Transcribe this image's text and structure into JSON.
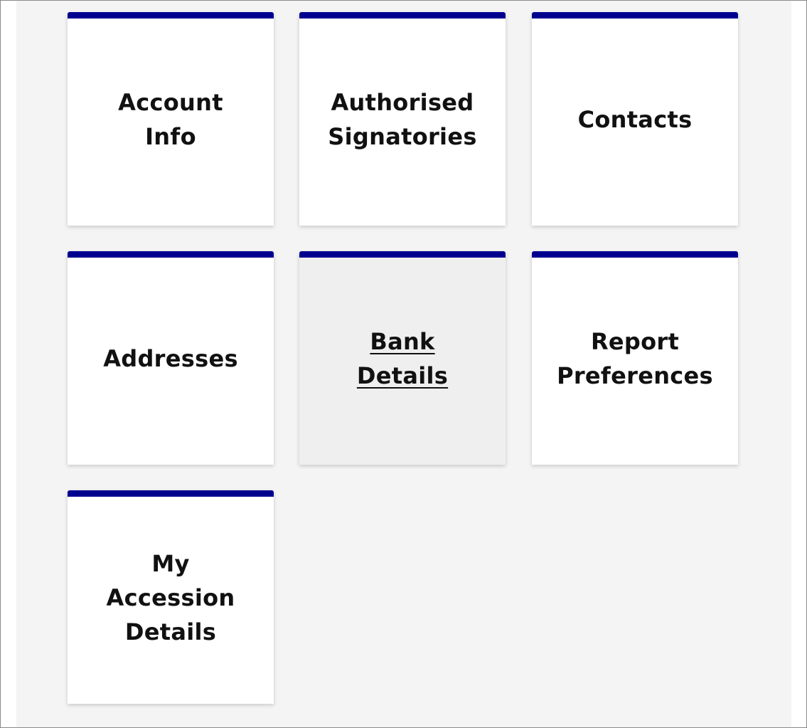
{
  "tiles": [
    {
      "id": "account-info",
      "lines": [
        "Account",
        "Info"
      ]
    },
    {
      "id": "authorised-signatories",
      "lines": [
        "Authorised",
        "Signatories"
      ]
    },
    {
      "id": "contacts",
      "lines": [
        "Contacts"
      ]
    },
    {
      "id": "addresses",
      "lines": [
        "Addresses"
      ]
    },
    {
      "id": "bank-details",
      "lines": [
        "Bank",
        "Details"
      ],
      "state": "hover"
    },
    {
      "id": "report-preferences",
      "lines": [
        "Report",
        "Preferences"
      ]
    },
    {
      "id": "my-accession-details",
      "lines": [
        "My",
        "Accession",
        "Details"
      ]
    }
  ],
  "colors": {
    "accent": "#00008f",
    "tile_background": "#ffffff",
    "tile_hover_background": "#efefef",
    "panel_background": "#f4f4f4",
    "text": "#111111"
  }
}
